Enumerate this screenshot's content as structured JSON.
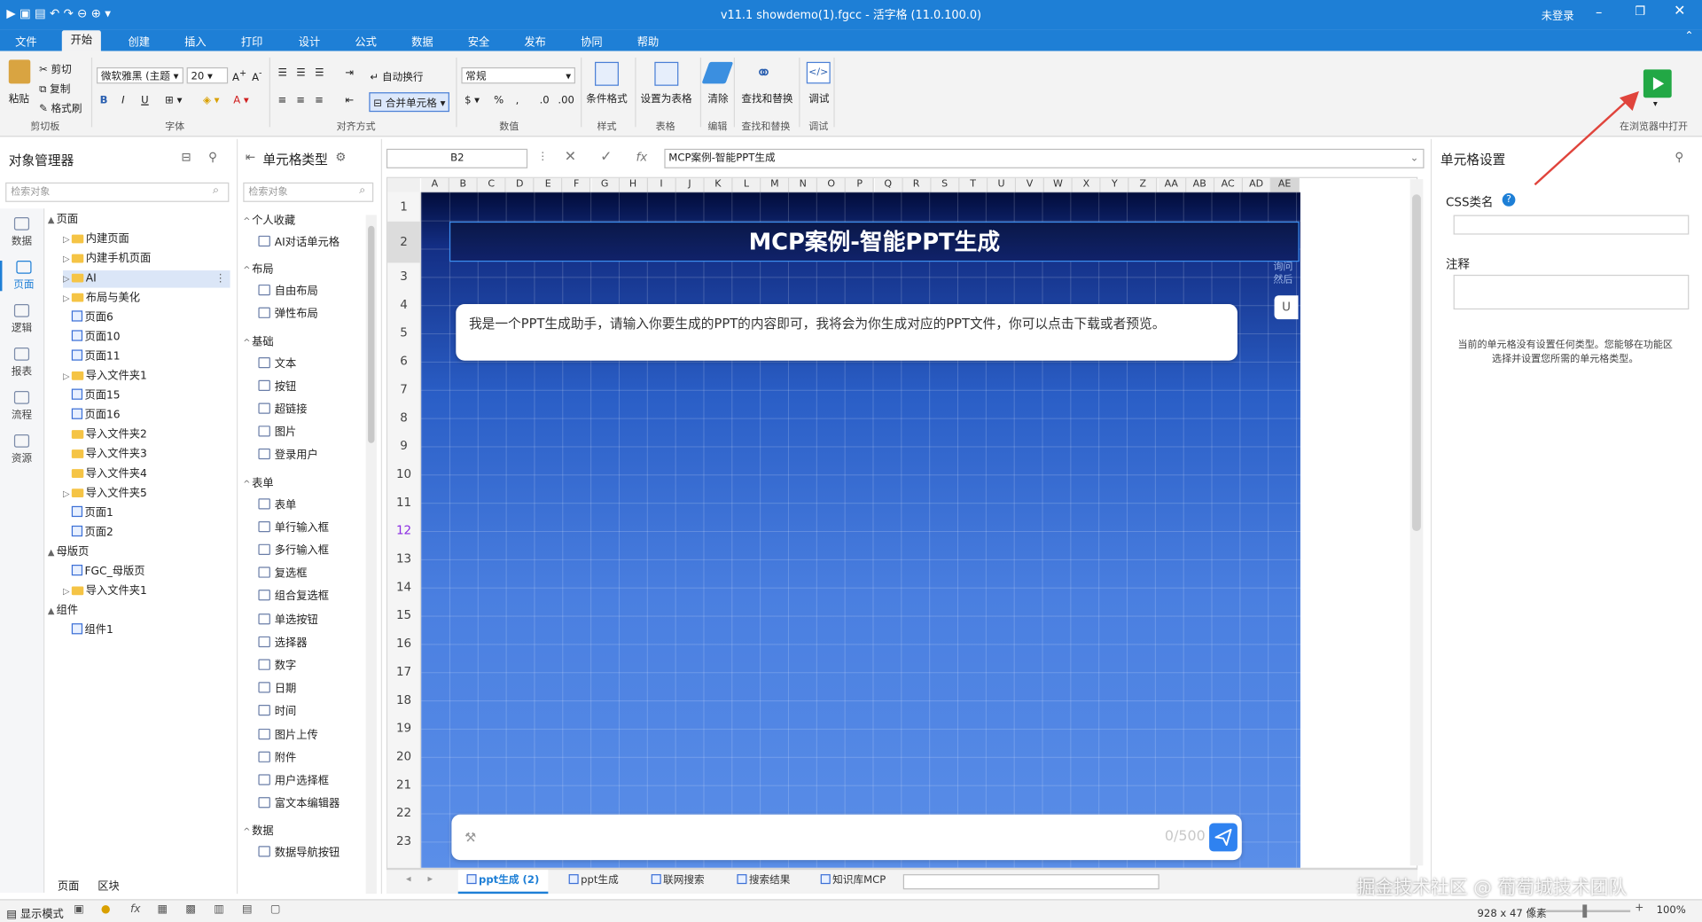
{
  "title_bar": {
    "title": "v11.1  showdemo(1).fgcc - 活字格 (11.0.100.0)",
    "login": "未登录"
  },
  "menu": [
    "文件",
    "开始",
    "创建",
    "插入",
    "打印",
    "设计",
    "公式",
    "数据",
    "安全",
    "发布",
    "协同",
    "帮助"
  ],
  "ribbon": {
    "clipboard": {
      "paste": "粘贴",
      "cut": "剪切",
      "copy": "复制",
      "format_painter": "格式刷",
      "label": "剪切板"
    },
    "font": {
      "font_name": "微软雅黑 (主题",
      "font_size": "20",
      "label": "字体"
    },
    "align": {
      "wrap": "自动换行",
      "merge": "合并单元格",
      "label": "对齐方式"
    },
    "number": {
      "format": "常规",
      "label": "数值"
    },
    "style": {
      "cond_format": "条件格式",
      "label": "样式"
    },
    "table": {
      "set_table": "设置为表格",
      "label": "表格"
    },
    "edit": {
      "clear": "清除",
      "label": "编辑"
    },
    "find": {
      "find_replace": "查找和替换",
      "label": "查找和替换"
    },
    "debug": {
      "debug": "调试",
      "label": "调试"
    },
    "run_label": "在浏览器中打开"
  },
  "object_manager": {
    "title": "对象管理器",
    "search_placeholder": "检索对象",
    "tree": [
      {
        "label": "页面",
        "indent": 0,
        "icon": "none",
        "caret": "▲"
      },
      {
        "label": "内建页面",
        "indent": 1,
        "icon": "folder",
        "caret": "▷"
      },
      {
        "label": "内建手机页面",
        "indent": 1,
        "icon": "folder",
        "caret": "▷"
      },
      {
        "label": "AI",
        "indent": 1,
        "icon": "folder",
        "caret": "▷",
        "selected": true
      },
      {
        "label": "布局与美化",
        "indent": 1,
        "icon": "folder",
        "caret": "▷"
      },
      {
        "label": "页面6",
        "indent": 1,
        "icon": "page",
        "caret": ""
      },
      {
        "label": "页面10",
        "indent": 1,
        "icon": "page",
        "caret": ""
      },
      {
        "label": "页面11",
        "indent": 1,
        "icon": "page",
        "caret": ""
      },
      {
        "label": "导入文件夹1",
        "indent": 1,
        "icon": "folder",
        "caret": "▷"
      },
      {
        "label": "页面15",
        "indent": 1,
        "icon": "page",
        "caret": ""
      },
      {
        "label": "页面16",
        "indent": 1,
        "icon": "page",
        "caret": ""
      },
      {
        "label": "导入文件夹2",
        "indent": 1,
        "icon": "folder",
        "caret": ""
      },
      {
        "label": "导入文件夹3",
        "indent": 1,
        "icon": "folder",
        "caret": ""
      },
      {
        "label": "导入文件夹4",
        "indent": 1,
        "icon": "folder",
        "caret": ""
      },
      {
        "label": "导入文件夹5",
        "indent": 1,
        "icon": "folder",
        "caret": "▷"
      },
      {
        "label": "页面1",
        "indent": 1,
        "icon": "page",
        "caret": ""
      },
      {
        "label": "页面2",
        "indent": 1,
        "icon": "page",
        "caret": ""
      },
      {
        "label": "母版页",
        "indent": 0,
        "icon": "none",
        "caret": "▲"
      },
      {
        "label": "FGC_母版页",
        "indent": 1,
        "icon": "page",
        "caret": ""
      },
      {
        "label": "导入文件夹1",
        "indent": 1,
        "icon": "folder",
        "caret": "▷"
      },
      {
        "label": "组件",
        "indent": 0,
        "icon": "none",
        "caret": "▲"
      },
      {
        "label": "组件1",
        "indent": 1,
        "icon": "page",
        "caret": ""
      }
    ],
    "bottom_tabs": [
      "页面",
      "区块"
    ]
  },
  "left_tabs": [
    "数据",
    "页面",
    "逻辑",
    "报表",
    "流程",
    "资源"
  ],
  "cell_types": {
    "title": "单元格类型",
    "search_placeholder": "检索对象",
    "items": [
      {
        "label": "个人收藏",
        "header": true
      },
      {
        "label": "AI对话单元格",
        "header": false
      },
      {
        "label": "布局",
        "header": true
      },
      {
        "label": "自由布局",
        "header": false
      },
      {
        "label": "弹性布局",
        "header": false
      },
      {
        "label": "基础",
        "header": true
      },
      {
        "label": "文本",
        "header": false
      },
      {
        "label": "按钮",
        "header": false
      },
      {
        "label": "超链接",
        "header": false
      },
      {
        "label": "图片",
        "header": false
      },
      {
        "label": "登录用户",
        "header": false
      },
      {
        "label": "表单",
        "header": true
      },
      {
        "label": "表单",
        "header": false
      },
      {
        "label": "单行输入框",
        "header": false
      },
      {
        "label": "多行输入框",
        "header": false
      },
      {
        "label": "复选框",
        "header": false
      },
      {
        "label": "组合复选框",
        "header": false
      },
      {
        "label": "单选按钮",
        "header": false
      },
      {
        "label": "选择器",
        "header": false
      },
      {
        "label": "数字",
        "header": false
      },
      {
        "label": "日期",
        "header": false
      },
      {
        "label": "时间",
        "header": false
      },
      {
        "label": "图片上传",
        "header": false
      },
      {
        "label": "附件",
        "header": false
      },
      {
        "label": "用户选择框",
        "header": false
      },
      {
        "label": "富文本编辑器",
        "header": false
      },
      {
        "label": "数据",
        "header": true
      },
      {
        "label": "数据导航按钮",
        "header": false
      }
    ]
  },
  "formula_bar": {
    "cell_ref": "B2",
    "fx": "fx",
    "content": "MCP案例-智能PPT生成"
  },
  "sheet": {
    "columns": [
      "A",
      "B",
      "C",
      "D",
      "E",
      "F",
      "G",
      "H",
      "I",
      "J",
      "K",
      "L",
      "M",
      "N",
      "O",
      "P",
      "Q",
      "R",
      "S",
      "T",
      "U",
      "V",
      "W",
      "X",
      "Y",
      "Z",
      "AA",
      "AB",
      "AC",
      "AD",
      "AE"
    ],
    "rows": [
      "1",
      "2",
      "3",
      "4",
      "5",
      "6",
      "7",
      "8",
      "9",
      "10",
      "11",
      "12",
      "13",
      "14",
      "15",
      "16",
      "17",
      "18",
      "19",
      "20",
      "21",
      "22",
      "23"
    ],
    "header_text": "MCP案例-智能PPT生成",
    "assistant_message": "我是一个PPT生成助手，请输入你要生成的PPT的内容即可，我将会为你生成对应的PPT文件，你可以点击下载或者预览。",
    "input_counter": "0/500",
    "right_side_ghost": [
      "询问",
      "然后"
    ],
    "right_side_button": "U"
  },
  "sheet_tabs": [
    "ppt生成 (2)",
    "ppt生成",
    "联网搜索",
    "搜索结果",
    "知识库MCP"
  ],
  "props_panel": {
    "title": "单元格设置",
    "css_label": "CSS类名",
    "note_label": "注释",
    "message": "当前的单元格没有设置任何类型。您能够在功能区选择并设置您所需的单元格类型。"
  },
  "status_bar": {
    "mode": "显示模式",
    "size": "928 x 47 像素",
    "zoom": "100%"
  },
  "watermark": "掘金技术社区 @ 葡萄城技术团队",
  "colors": {
    "accent": "#1e7fd6",
    "sheet_top": "#020c3a",
    "sheet_bottom": "#4f86e6",
    "run_green": "#22a845"
  }
}
